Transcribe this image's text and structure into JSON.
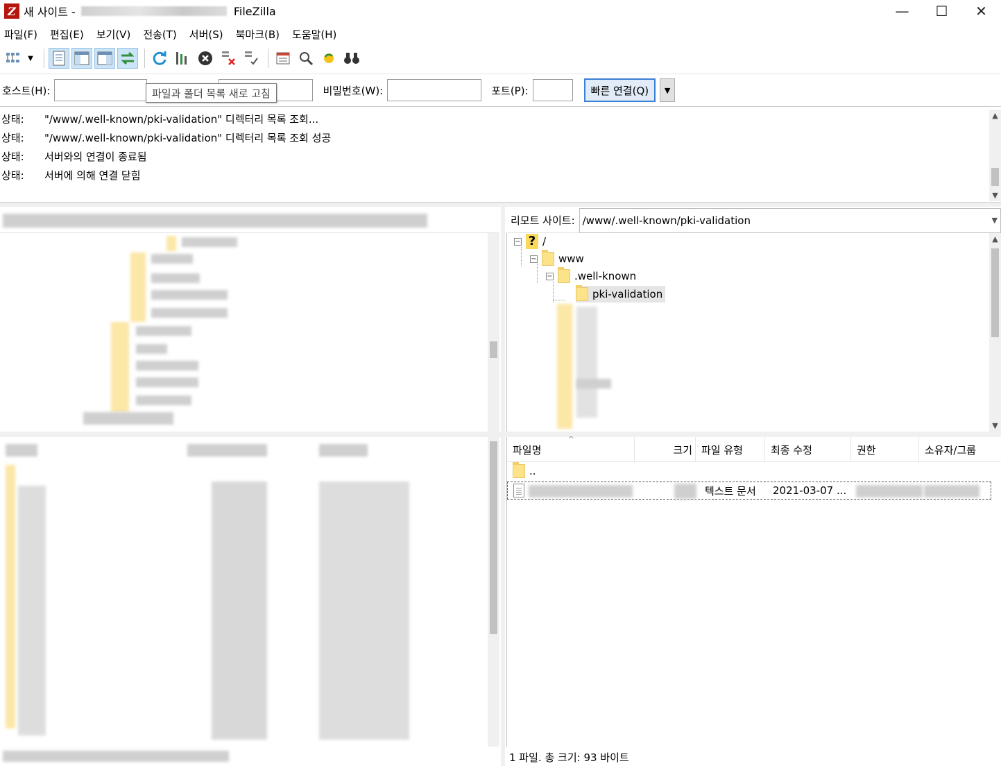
{
  "title": {
    "site": "새 사이트 -",
    "app": "FileZilla"
  },
  "window_controls": {
    "minimize": "—",
    "maximize": "☐",
    "close": "✕"
  },
  "menu": [
    "파일(F)",
    "편집(E)",
    "보기(V)",
    "전송(T)",
    "서버(S)",
    "북마크(B)",
    "도움말(H)"
  ],
  "toolbar": {
    "tooltip": "파일과 폴더 목록 새로 고침",
    "icons": [
      "site-manager-icon",
      "toggle-log-icon",
      "toggle-local-tree-icon",
      "toggle-remote-tree-icon",
      "toggle-queue-icon",
      "refresh-icon",
      "process-queue-icon",
      "cancel-icon",
      "disconnect-icon",
      "reconnect-icon",
      "filter-icon",
      "compare-icon",
      "sync-browse-icon",
      "search-icon"
    ]
  },
  "quickconnect": {
    "host_label": "호스트(H):",
    "host_value": "",
    "user_value": "",
    "password_label": "비밀번호(W):",
    "password_value": "",
    "port_label": "포트(P):",
    "port_value": "",
    "connect_label": "빠른 연결(Q)",
    "dropdown": "▼"
  },
  "log": [
    {
      "status": "상태:",
      "message": "\"/www/.well-known/pki-validation\" 디렉터리 목록 조회..."
    },
    {
      "status": "상태:",
      "message": "\"/www/.well-known/pki-validation\" 디렉터리 목록 조회 성공"
    },
    {
      "status": "상태:",
      "message": "서버와의 연결이 종료됨"
    },
    {
      "status": "상태:",
      "message": "서버에 의해 연결 닫힘"
    }
  ],
  "remote": {
    "site_label": "리모트 사이트:",
    "site_path": "/www/.well-known/pki-validation",
    "tree": [
      {
        "label": "/",
        "expander": "⊟"
      },
      {
        "label": "www",
        "expander": "⊟"
      },
      {
        "label": ".well-known",
        "expander": "⊟"
      },
      {
        "label": "pki-validation",
        "expander": ""
      }
    ],
    "columns": [
      "파일명",
      "크기",
      "파일 유형",
      "최종 수정",
      "권한",
      "소유자/그룹"
    ],
    "rows": [
      {
        "name": "..",
        "size": "",
        "type": "",
        "modified": "",
        "perms": "",
        "owner": ""
      },
      {
        "name": "",
        "size": "",
        "type": "텍스트 문서",
        "modified": "2021-03-07 ...",
        "perms": "",
        "owner": ""
      }
    ],
    "status": "1 파일. 총 크기: 93 바이트"
  },
  "colors": {
    "accent": "#3c7fd6",
    "folder": "#fce38a",
    "pressed": "#cce4f7"
  }
}
